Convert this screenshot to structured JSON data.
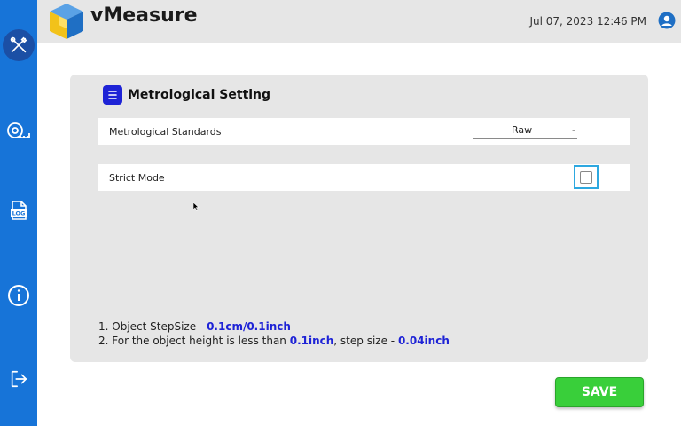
{
  "app": {
    "title": "vMeasure"
  },
  "header": {
    "datetime": "Jul 07, 2023 12:46 PM"
  },
  "sidebar": {
    "items": [
      {
        "icon": "tools-icon",
        "active": true
      },
      {
        "icon": "tape-measure-icon",
        "active": false
      },
      {
        "icon": "log-icon",
        "label": "LOG",
        "active": false
      },
      {
        "icon": "info-icon",
        "active": false
      },
      {
        "icon": "logout-icon",
        "active": false
      }
    ]
  },
  "settings": {
    "title": "Metrological Setting",
    "standards_label": "Metrological Standards",
    "standards_value": "Raw",
    "standards_caret": "-",
    "strict_mode_label": "Strict Mode",
    "strict_mode_checked": false
  },
  "notes": {
    "line1_prefix": "1. Object StepSize - ",
    "line1_value": "0.1cm/0.1inch",
    "line2_prefix": "2. For the object height is less than ",
    "line2_value1": "0.1inch",
    "line2_mid": ", step size - ",
    "line2_value2": "0.04inch"
  },
  "actions": {
    "save_label": "SAVE"
  },
  "colors": {
    "sidebar": "#1774d8",
    "accent": "#1e23d6",
    "save": "#39cf3a",
    "checkbox_border": "#2da8e0"
  }
}
